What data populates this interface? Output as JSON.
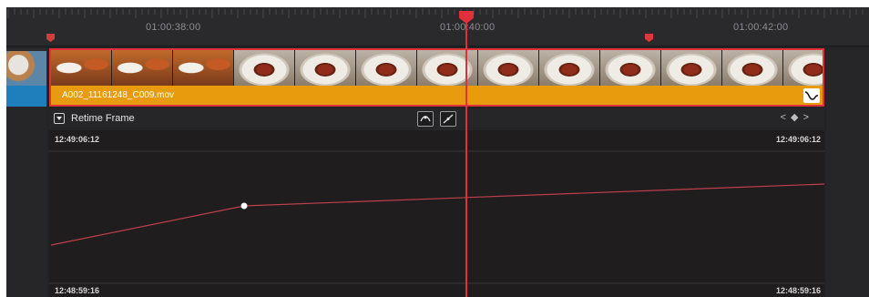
{
  "ruler": {
    "timecodes": [
      "01:00:38:00",
      "01:00:40:00",
      "01:00:42:00"
    ]
  },
  "clip": {
    "name": "A002_11161248_C009.mov",
    "color": "#e89b0c",
    "selection_color": "#e0303a"
  },
  "retime": {
    "title": "Retime Frame",
    "top_left_tc": "12:49:06:12",
    "top_right_tc": "12:49:06:12",
    "bottom_left_tc": "12:48:59:16",
    "bottom_right_tc": "12:48:59:16",
    "kf_nav": "< ◆ >",
    "buttons": [
      "ease-curve-icon",
      "linear-curve-icon"
    ]
  },
  "colors": {
    "playhead": "#e0303a",
    "track_blue": "#1f7fbd",
    "curve_line": "#c0404a"
  }
}
